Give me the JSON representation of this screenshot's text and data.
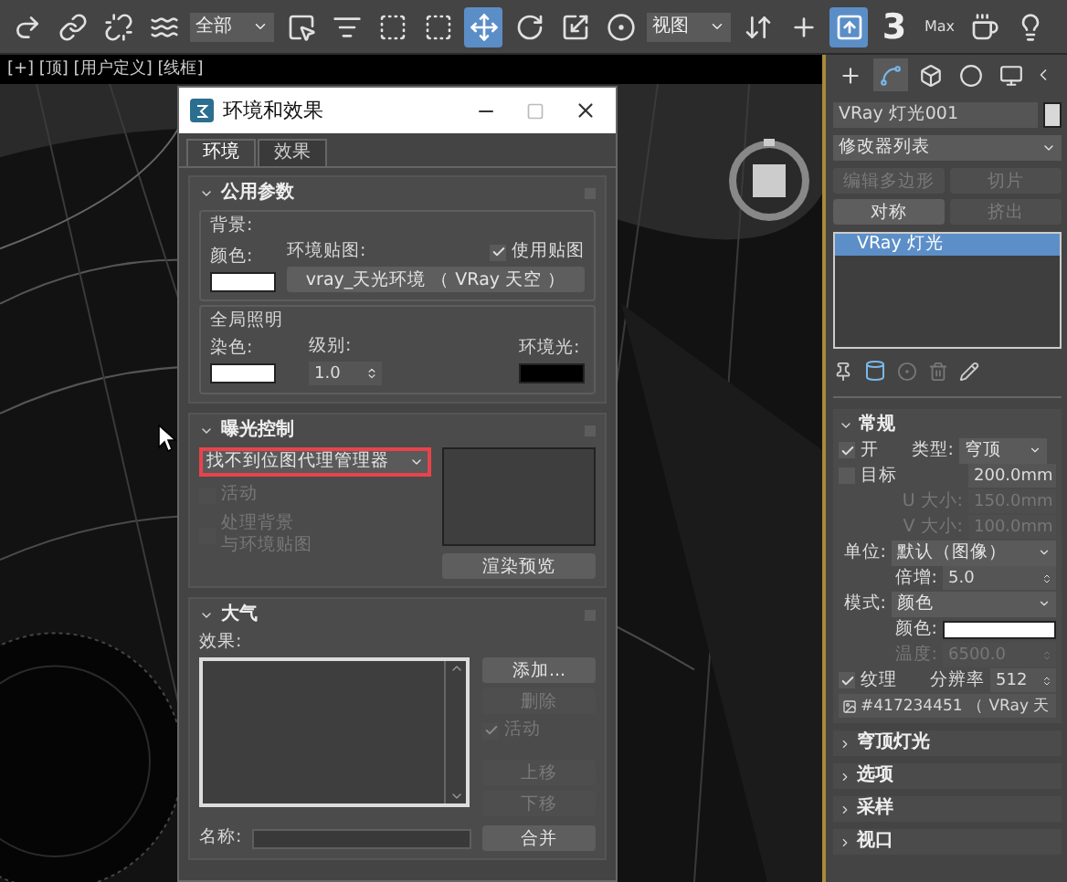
{
  "toolbar": {
    "items": [
      {
        "kind": "tool",
        "selected": false
      },
      {
        "kind": "tool",
        "selected": false
      },
      {
        "kind": "tool",
        "selected": false
      },
      {
        "kind": "tool",
        "selected": false
      },
      {
        "kind": "dropdown",
        "value": "全部"
      },
      {
        "kind": "tool",
        "selected": false
      },
      {
        "kind": "tool",
        "selected": false
      },
      {
        "kind": "tool",
        "selected": false
      },
      {
        "kind": "tool",
        "selected": false
      },
      {
        "kind": "tool",
        "selected": true
      },
      {
        "kind": "tool",
        "selected": false
      },
      {
        "kind": "tool",
        "selected": false
      },
      {
        "kind": "tool",
        "selected": false
      },
      {
        "kind": "dropdown",
        "value": "视图"
      },
      {
        "kind": "tool",
        "selected": false
      },
      {
        "kind": "tool",
        "selected": false
      },
      {
        "kind": "tool",
        "selected": true
      },
      {
        "kind": "snap",
        "label": "3"
      },
      {
        "kind": "label",
        "label": "Max"
      },
      {
        "kind": "tool",
        "selected": false
      },
      {
        "kind": "tool",
        "selected": false
      }
    ]
  },
  "viewport": {
    "label": "[+] [顶] [用户定义] [线框]"
  },
  "dialog": {
    "title": "环境和效果",
    "tabs": [
      {
        "label": "环境",
        "selected": true
      },
      {
        "label": "效果",
        "selected": false
      }
    ],
    "common": {
      "title": "公用参数",
      "background_label": "背景:",
      "color_label": "颜色:",
      "env_map_label": "环境贴图:",
      "use_map": {
        "label": "使用贴图",
        "checked": true
      },
      "env_map_button": "vray_天光环境 （ VRay 天空 ）",
      "gi_label": "全局照明",
      "tint_label": "染色:",
      "level_label": "级别:",
      "level_value": "1.0",
      "ambient_label": "环境光:"
    },
    "exposure": {
      "title": "曝光控制",
      "dropdown": {
        "value": "找不到位图代理管理器",
        "highlighted": true
      },
      "active": {
        "label": "活动",
        "checked": false,
        "disabled": true
      },
      "process_bg": {
        "label_lines": [
          "处理背景",
          "与环境贴图"
        ],
        "checked": false,
        "disabled": true
      },
      "render_preview": "渲染预览"
    },
    "atmosphere": {
      "title": "大气",
      "effects_label": "效果:",
      "buttons": [
        {
          "label": "添加...",
          "disabled": false
        },
        {
          "label": "删除",
          "disabled": true
        }
      ],
      "active": {
        "label": "活动",
        "checked": true,
        "disabled": true
      },
      "move_buttons": [
        {
          "label": "上移",
          "disabled": true
        },
        {
          "label": "下移",
          "disabled": true
        }
      ],
      "name_label": "名称:",
      "merge": "合并"
    }
  },
  "command_panel": {
    "tabs": [
      {
        "selected": false
      },
      {
        "selected": true
      },
      {
        "selected": false
      },
      {
        "selected": false
      },
      {
        "selected": false
      }
    ],
    "object_name": "VRay 灯光001",
    "modifier_list": "修改器列表",
    "modifier_buttons": [
      {
        "label": "编辑多边形",
        "disabled": true
      },
      {
        "label": "切片",
        "disabled": true
      },
      {
        "label": "对称",
        "disabled": false
      },
      {
        "label": "挤出",
        "disabled": true
      }
    ],
    "stack": [
      {
        "label": "VRay 灯光",
        "selected": true
      }
    ],
    "general": {
      "title": "常规",
      "on": {
        "label": "开",
        "checked": true
      },
      "type_label": "类型:",
      "type_value": "穹顶",
      "target": {
        "label": "目标",
        "checked": false
      },
      "target_value": "200.0mm",
      "u_label": "U 大小:",
      "u_value": "150.0mm",
      "v_label": "V 大小:",
      "v_value": "100.0mm",
      "size_disabled": true,
      "unit_label": "单位:",
      "unit_value": "默认（图像）",
      "multiplier_label": "倍增:",
      "multiplier_value": "5.0",
      "mode_label": "模式:",
      "mode_value": "颜色",
      "color_label": "颜色:",
      "temp_label": "温度:",
      "temp_value": "6500.0",
      "temp_disabled": true,
      "texture": {
        "label": "纹理",
        "checked": true
      },
      "resolution_label": "分辨率",
      "resolution_value": "512",
      "map_button": "#417234451 （ VRay 天"
    },
    "collapsed": [
      {
        "title": "穹顶灯光"
      },
      {
        "title": "选项"
      },
      {
        "title": "采样"
      },
      {
        "title": "视口"
      }
    ]
  }
}
